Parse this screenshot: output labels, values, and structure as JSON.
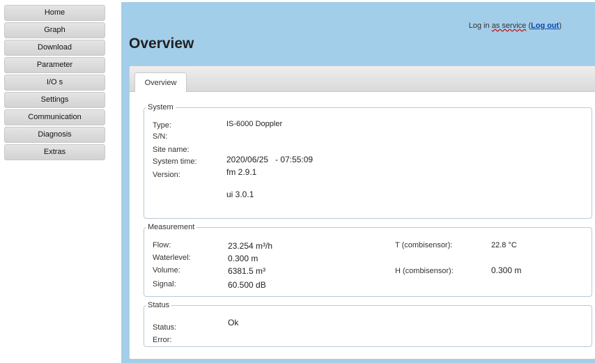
{
  "nav": {
    "items": [
      {
        "label": "Home"
      },
      {
        "label": "Graph"
      },
      {
        "label": "Download"
      },
      {
        "label": "Parameter"
      },
      {
        "label": "I/O s"
      },
      {
        "label": "Settings"
      },
      {
        "label": "Communication"
      },
      {
        "label": "Diagnosis"
      },
      {
        "label": "Extras"
      }
    ]
  },
  "header": {
    "login_prefix": "Log in",
    "login_role": "as service",
    "login_open": "(",
    "logout_label": "Log out",
    "login_close": ")",
    "title": "Overview"
  },
  "tabs": [
    {
      "label": "Overview"
    }
  ],
  "system": {
    "legend": "System",
    "type_label": "Type:",
    "type_value": "IS-6000 Doppler",
    "sn_label": "S/N:",
    "site_label": "Site name:",
    "time_label": "System time:",
    "time_value": "2020/06/25   - 07:55:09",
    "version_label": "Version:",
    "fm_version": "fm 2.9.1",
    "ui_version": "ui 3.0.1"
  },
  "measurement": {
    "legend": "Measurement",
    "flow_label": "Flow:",
    "flow_value": "23.254 m³/h",
    "waterlevel_label": "Waterlevel:",
    "waterlevel_value": "0.300 m",
    "volume_label": "Volume:",
    "volume_value": "6381.5 m³",
    "signal_label": "Signal:",
    "signal_value": "60.500 dB",
    "t_label": "T (combisensor):",
    "t_value": "22.8 °C",
    "h_label": "H (combisensor):",
    "h_value": "0.300 m"
  },
  "status": {
    "legend": "Status",
    "status_label": "Status:",
    "status_value": "Ok",
    "error_label": "Error:"
  }
}
